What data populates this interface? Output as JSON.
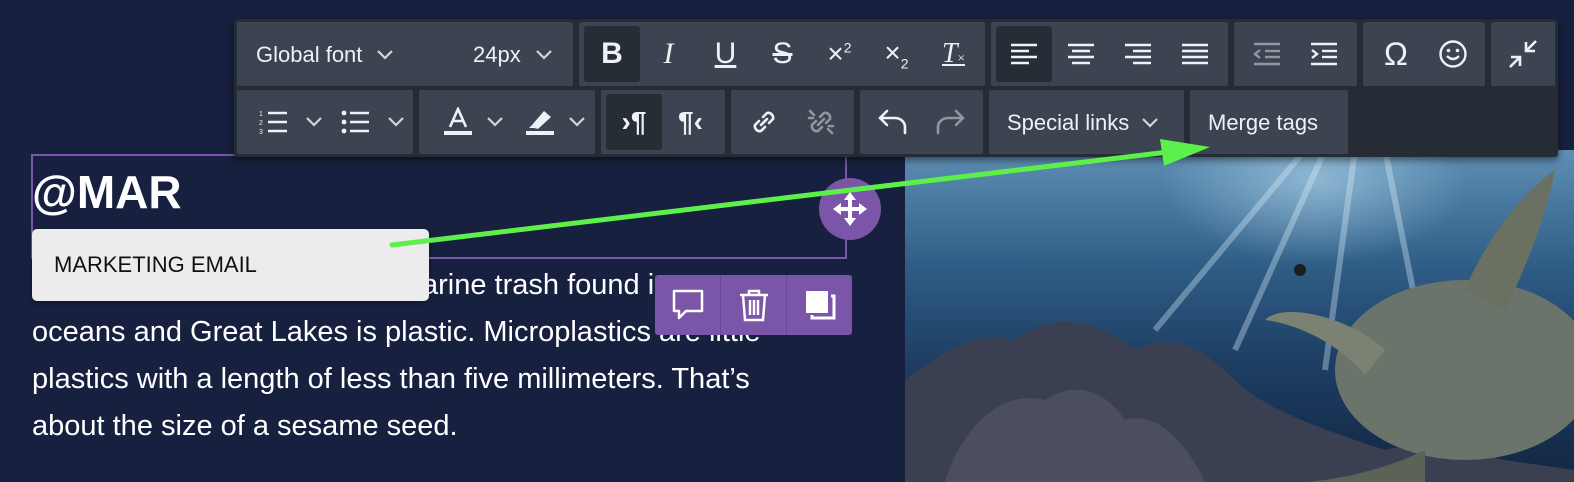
{
  "toolbar": {
    "font_family": "Global font",
    "font_size": "24px",
    "special_links_label": "Special links",
    "merge_tags_label": "Merge tags"
  },
  "content": {
    "headline": "@MAR",
    "paragraph_lines": [
      "arine trash found i",
      "oceans and Great Lakes is plastic. Microplastics are little",
      "plastics with a length of less than five millimeters. That’s",
      "about the size of a sesame seed."
    ]
  },
  "suggestion": {
    "item": "MARKETING EMAIL"
  },
  "colors": {
    "background": "#17203f",
    "toolbar": "#252c35",
    "toolbar_group": "#3b4450",
    "selection_purple": "#7a55a8",
    "annotation_arrow": "#5ef04a"
  }
}
